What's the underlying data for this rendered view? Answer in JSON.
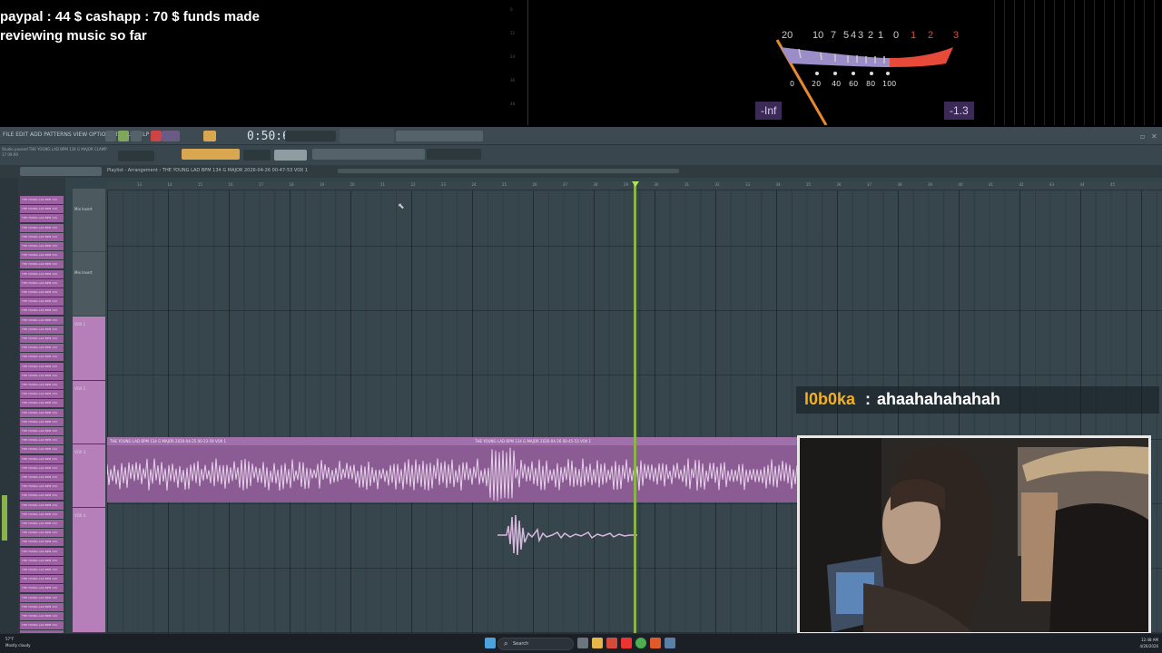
{
  "overlay": {
    "donation_line1": "paypal : 44 $  cashapp : 70 $ funds made",
    "donation_line2": "reviewing music so far",
    "vu_meter": {
      "scale_top": [
        "20",
        "10",
        "7",
        "5",
        "4",
        "3",
        "2",
        "1",
        "0",
        "1",
        "2",
        "3"
      ],
      "scale_bottom": [
        "0",
        "20",
        "40",
        "60",
        "80",
        "100"
      ],
      "readout_left": "-Inf",
      "readout_right": "-1.3"
    }
  },
  "daw": {
    "menu": "FILE EDIT ADD PATTERNS VIEW OPTIONS TOOLS HELP",
    "time": "0:50:67",
    "hint_line1": "Studio paused  THE YOUNG LAD BPM 134 G MAJOR CLAMP",
    "hint_line2": "17 09:09",
    "playlist_title": "Playlist - Arrangement  ›  THE YOUNG LAD BPM 134 G MAJOR 2026-04-26 00-47-53 VOX 1",
    "browser_item_label": "THE YOUNG LAD BPM 134",
    "track_labels": [
      "Mix Insert",
      "Mix Insert",
      "VOX 1",
      "VOX 2",
      "VOX 3",
      "VOX 4"
    ],
    "clip_title_a": "THE YOUNG LAD BPM 134 G MAJOR 2026-04-25 00-23-59 VOX 1",
    "clip_title_b": "THE YOUNG LAD BPM 134 G MAJOR 2026-04-26 00-45-53 VOX 1",
    "ruler_marks": [
      "13",
      "14",
      "15",
      "16",
      "17",
      "18",
      "19",
      "20",
      "21",
      "22",
      "23",
      "24",
      "25",
      "26",
      "27",
      "28",
      "29",
      "30",
      "31",
      "32",
      "33",
      "34",
      "35",
      "36",
      "37",
      "38",
      "39",
      "40",
      "41",
      "42",
      "43",
      "44",
      "45"
    ],
    "playhead_position_bar": 29
  },
  "chat": {
    "username": "l0b0ka",
    "separator": ":",
    "message": "ahaahahahahah",
    "username_color": "#f5b021"
  },
  "taskbar": {
    "weather": "57°F",
    "weather_desc": "Mostly cloudy",
    "search_placeholder": "Search",
    "time": "12:48 AM",
    "date": "4/26/2026"
  },
  "colors": {
    "clip": "#8b5c94",
    "playhead": "#8ab34a",
    "daw_bg": "#36464c",
    "vu_red": "#e84a3a",
    "vu_needle": "#e88a2a"
  }
}
